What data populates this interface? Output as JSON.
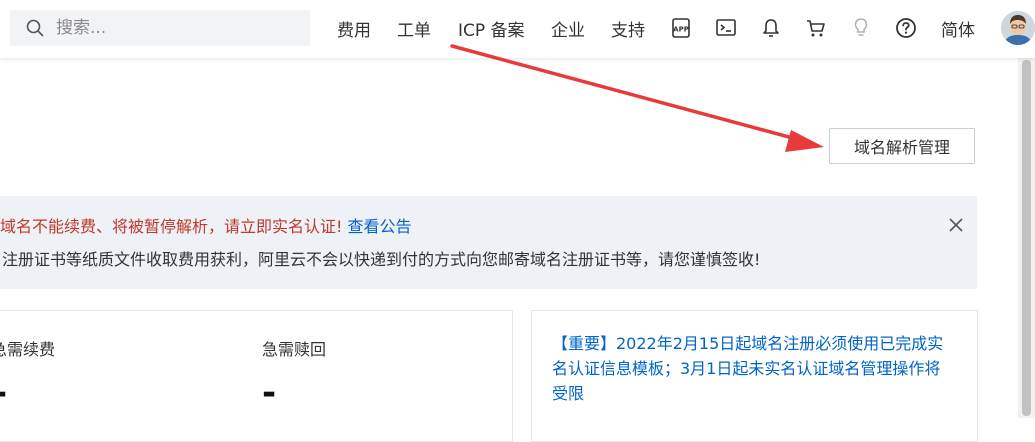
{
  "search": {
    "placeholder": "搜索..."
  },
  "nav": {
    "fees": "费用",
    "ticket": "工单",
    "icp": "ICP 备案",
    "enterprise": "企业",
    "support": "支持",
    "language": "简体"
  },
  "icons": [
    "search-icon",
    "app-icon",
    "terminal-icon",
    "bell-icon",
    "cart-icon",
    "lightbulb-icon",
    "help-icon",
    "avatar"
  ],
  "colors": {
    "accent": "#0064c8",
    "warning": "#c0392b",
    "arrow": "#e83a3a"
  },
  "main": {
    "dns_button": "域名解析管理",
    "alert": {
      "warning_text": "域名不能续费、将被暂停解析，请立即实名认证!",
      "link_text": "查看公告",
      "line2": "注册证书等纸质文件收取费用获利，阿里云不会以快递到付的方式向您邮寄域名注册证书等，请您谨慎签收!"
    },
    "stats": [
      {
        "label": "急需续费",
        "value": "-"
      },
      {
        "label": "急需赎回",
        "value": "-"
      }
    ],
    "notice": "【重要】2022年2月15日起域名注册必须使用已完成实名认证信息模板；3月1日起未实名认证域名管理操作将受限"
  }
}
